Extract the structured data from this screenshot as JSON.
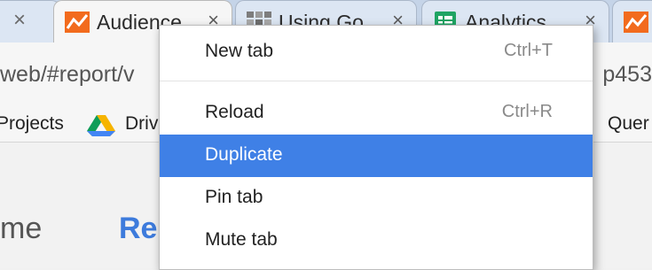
{
  "tabs": [
    {
      "title": "",
      "close": "×"
    },
    {
      "title": "Audience",
      "close": "×"
    },
    {
      "title": "Using Go",
      "close": "×"
    },
    {
      "title": "Analytics",
      "close": "×"
    }
  ],
  "toolbar": {
    "url_left": "web/#report/v",
    "url_right": "p453"
  },
  "bookmarks": [
    {
      "label": "Projects"
    },
    {
      "label": "Driv"
    },
    {
      "label": "Quer"
    }
  ],
  "page": {
    "left_text": "me",
    "blue_text": "Re"
  },
  "context_menu": {
    "items": [
      {
        "label": "New tab",
        "shortcut": "Ctrl+T"
      },
      {
        "label": "Reload",
        "shortcut": "Ctrl+R"
      },
      {
        "label": "Duplicate",
        "shortcut": ""
      },
      {
        "label": "Pin tab",
        "shortcut": ""
      },
      {
        "label": "Mute tab",
        "shortcut": ""
      }
    ],
    "highlighted": "Duplicate"
  },
  "colors": {
    "menu_highlight": "#3f80e6",
    "link_blue": "#3d7bdc",
    "analytics_orange": "#f26b1d",
    "sheets_green": "#1fa463"
  },
  "icons": [
    "analytics-favicon",
    "grid-favicon",
    "sheets-favicon",
    "drive-icon",
    "close-icon"
  ]
}
